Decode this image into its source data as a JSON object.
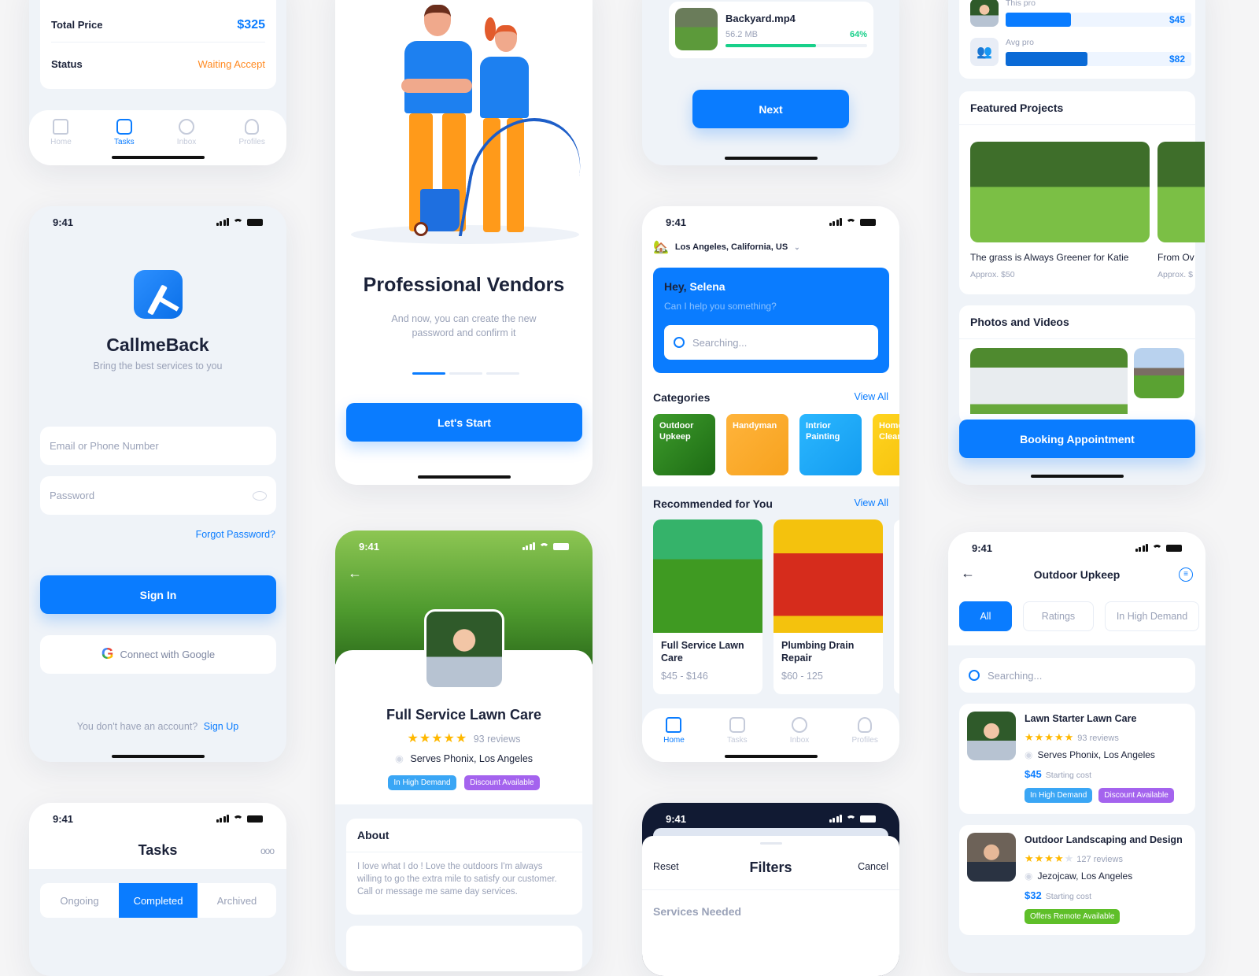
{
  "status_bar": {
    "time": "9:41"
  },
  "order_detail": {
    "rows": [
      {
        "label": "Total Price",
        "value": "$325",
        "color": "#0a7cff"
      },
      {
        "label": "Status",
        "value": "Waiting Accept",
        "color": "#ff8a22"
      }
    ]
  },
  "bottom_nav": {
    "items": [
      {
        "label": "Home",
        "icon": "home-icon"
      },
      {
        "label": "Tasks",
        "icon": "clipboard-icon"
      },
      {
        "label": "Inbox",
        "icon": "chat-icon"
      },
      {
        "label": "Profiles",
        "icon": "user-icon"
      }
    ]
  },
  "login": {
    "app_name": "CallmeBack",
    "tagline": "Bring the best services to you",
    "email_placeholder": "Email or Phone Number",
    "password_placeholder": "Password",
    "forgot": "Forgot Password?",
    "sign_in": "Sign In",
    "google": "Connect with Google",
    "no_account": "You don't have an account?",
    "sign_up": "Sign Up"
  },
  "tasks": {
    "title": "Tasks",
    "tabs": [
      "Ongoing",
      "Completed",
      "Archived"
    ],
    "active_tab": "Completed"
  },
  "onboarding": {
    "title": "Professional Vendors",
    "subtitle_line1": "And now, you can create the new",
    "subtitle_line2": "password and confirm it",
    "page": 1,
    "pages": 3,
    "cta": "Let's Start"
  },
  "vendor_profile": {
    "name": "Full Service Lawn Care",
    "rating": 5,
    "reviews": "93 reviews",
    "location": "Serves Phonix, Los Angeles",
    "tags": [
      "In High Demand",
      "Discount Available"
    ],
    "about_title": "About",
    "about_line1": "I love what I do ! Love the outdoors I'm always",
    "about_line2": "willing to go the extra mile to satisfy our customer.",
    "about_line3": "Call or message me same day services."
  },
  "upload": {
    "file_name": "Backyard.mp4",
    "file_size": "56.2 MB",
    "progress_label": "64%",
    "progress": 0.64,
    "next": "Next"
  },
  "home": {
    "location": "Los Angeles, California, US",
    "greeting": "Hey,",
    "user": "Selena",
    "help": "Can I help you something?",
    "search_placeholder": "Searching...",
    "categories_title": "Categories",
    "view_all": "View All",
    "categories": [
      {
        "line1": "Outdoor",
        "line2": "Upkeep"
      },
      {
        "line1": "Handyman",
        "line2": ""
      },
      {
        "line1": "Intrior",
        "line2": "Painting"
      },
      {
        "line1": "Home",
        "line2": "Clean"
      }
    ],
    "recommended_title": "Recommended for You",
    "recommended": [
      {
        "line1": "Full Service Lawn",
        "line2": "Care",
        "price": "$45 - $146"
      },
      {
        "line1": "Plumbing Drain",
        "line2": "Repair",
        "price": "$60 - 125"
      }
    ]
  },
  "filters": {
    "reset": "Reset",
    "title": "Filters",
    "cancel": "Cancel",
    "section": "Services Needed"
  },
  "pro_detail": {
    "compare": [
      {
        "label": "This pro",
        "value": "$45",
        "fraction": 0.35
      },
      {
        "label": "Avg pro",
        "value": "$82",
        "fraction": 0.44
      }
    ],
    "featured_title": "Featured Projects",
    "projects": [
      {
        "title": "The grass is Always Greener for Katie",
        "price": "Approx. $50"
      },
      {
        "title": "From Ov",
        "price": "Approx. $"
      }
    ],
    "photos_title": "Photos and Videos",
    "booking": "Booking Appointment"
  },
  "category_list": {
    "title": "Outdoor Upkeep",
    "chips": [
      "All",
      "Ratings",
      "In High Demand"
    ],
    "active_chip": "All",
    "search_placeholder": "Searching...",
    "vendors": [
      {
        "name": "Lawn Starter Lawn Care",
        "rating": 5,
        "reviews": "93 reviews",
        "location": "Serves Phonix, Los Angeles",
        "price": "$45",
        "price_note": "Starting cost",
        "tags": [
          "In High Demand",
          "Discount Available"
        ]
      },
      {
        "name": "Outdoor Landscaping and Design",
        "rating": 4,
        "reviews": "127 reviews",
        "location": "Jezojcaw, Los Angeles",
        "price": "$32",
        "price_note": "Starting cost",
        "tags": [
          "Offers Remote Available"
        ]
      }
    ]
  }
}
